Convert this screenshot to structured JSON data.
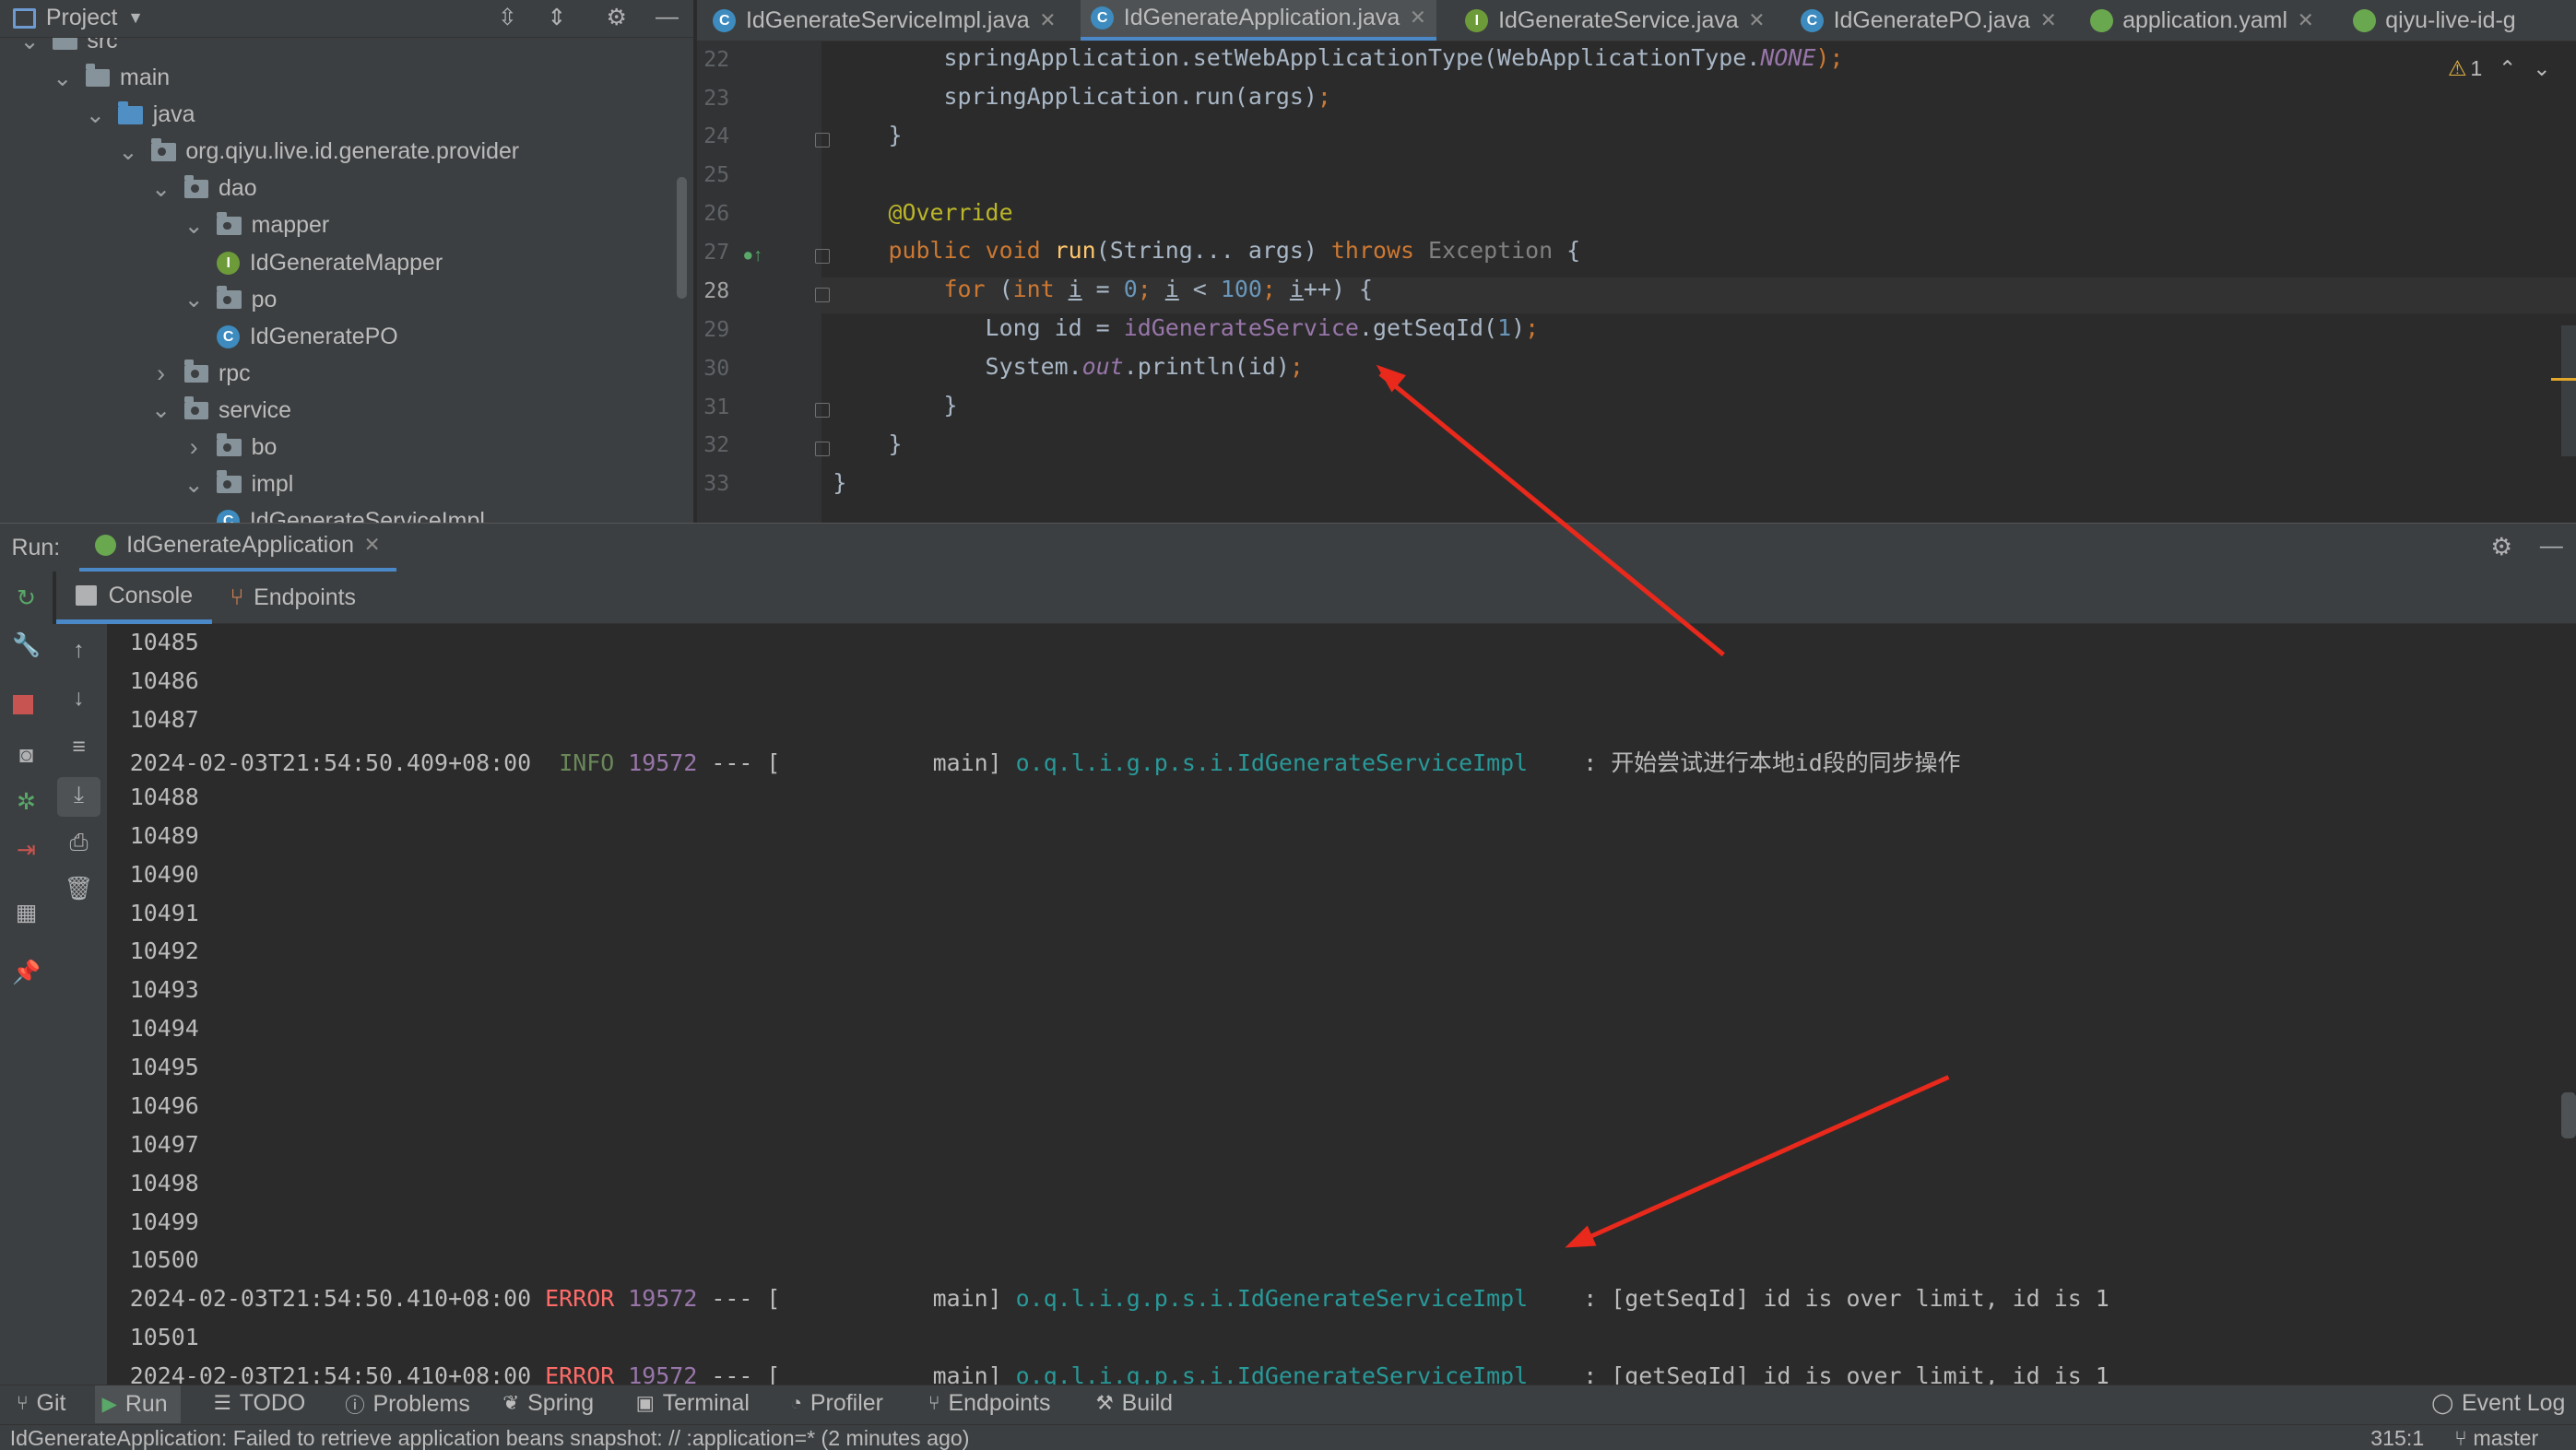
{
  "project_panel": {
    "title": "Project",
    "tree": [
      {
        "label": "src",
        "depth": 2,
        "kind": "folder",
        "expanded": true
      },
      {
        "label": "main",
        "depth": 3,
        "kind": "folder",
        "expanded": true
      },
      {
        "label": "java",
        "depth": 4,
        "kind": "folder-blue",
        "expanded": true
      },
      {
        "label": "org.qiyu.live.id.generate.provider",
        "depth": 5,
        "kind": "package",
        "expanded": true
      },
      {
        "label": "dao",
        "depth": 6,
        "kind": "package",
        "expanded": true
      },
      {
        "label": "mapper",
        "depth": 7,
        "kind": "package",
        "expanded": true
      },
      {
        "label": "IdGenerateMapper",
        "depth": 8,
        "kind": "interface"
      },
      {
        "label": "po",
        "depth": 7,
        "kind": "package",
        "expanded": true
      },
      {
        "label": "IdGeneratePO",
        "depth": 8,
        "kind": "class"
      },
      {
        "label": "rpc",
        "depth": 6,
        "kind": "package",
        "expanded": false
      },
      {
        "label": "service",
        "depth": 6,
        "kind": "package",
        "expanded": true
      },
      {
        "label": "bo",
        "depth": 7,
        "kind": "package",
        "expanded": false
      },
      {
        "label": "impl",
        "depth": 7,
        "kind": "package",
        "expanded": true
      },
      {
        "label": "IdGenerateServiceImpl",
        "depth": 8,
        "kind": "class"
      }
    ]
  },
  "editor_tabs": [
    {
      "label": "IdGenerateServiceImpl.java",
      "icon": "C",
      "kind": "class",
      "active": false
    },
    {
      "label": "IdGenerateApplication.java",
      "icon": "C",
      "kind": "class",
      "active": true
    },
    {
      "label": "IdGenerateService.java",
      "icon": "I",
      "kind": "interface",
      "active": false
    },
    {
      "label": "IdGeneratePO.java",
      "icon": "C",
      "kind": "class",
      "active": false
    },
    {
      "label": "application.yaml",
      "icon": "",
      "kind": "spring",
      "active": false
    },
    {
      "label": "qiyu-live-id-g",
      "icon": "",
      "kind": "spring",
      "active": false
    }
  ],
  "editor": {
    "warning_count": "1",
    "line_numbers": [
      "22",
      "23",
      "24",
      "25",
      "26",
      "27",
      "28",
      "29",
      "30",
      "31",
      "32",
      "33"
    ],
    "current_line": "28",
    "code": [
      [
        {
          "t": "        springApplication.setWebApplicationType(WebApplicationType.",
          "c": ""
        },
        {
          "t": "NONE",
          "c": "fld itl"
        },
        {
          "t": ");",
          "c": "kw"
        }
      ],
      [
        {
          "t": "        springApplication.run(args)",
          "c": ""
        },
        {
          "t": ";",
          "c": "kw"
        }
      ],
      [
        {
          "t": "    }",
          "c": ""
        }
      ],
      [
        {
          "t": "",
          "c": ""
        }
      ],
      [
        {
          "t": "    @Override",
          "c": "ann"
        }
      ],
      [
        {
          "t": "    ",
          "c": ""
        },
        {
          "t": "public void ",
          "c": "kw"
        },
        {
          "t": "run",
          "c": "fn"
        },
        {
          "t": "(String... args) ",
          "c": ""
        },
        {
          "t": "throws ",
          "c": "kw"
        },
        {
          "t": "Exception",
          "c": "gray"
        },
        {
          "t": " {",
          "c": ""
        }
      ],
      [
        {
          "t": "        ",
          "c": ""
        },
        {
          "t": "for ",
          "c": "kw"
        },
        {
          "t": "(",
          "c": ""
        },
        {
          "t": "int ",
          "c": "kw"
        },
        {
          "t": "i",
          "c": "ul"
        },
        {
          "t": " = ",
          "c": ""
        },
        {
          "t": "0",
          "c": "num"
        },
        {
          "t": "; ",
          "c": "kw"
        },
        {
          "t": "i",
          "c": "ul"
        },
        {
          "t": " < ",
          "c": ""
        },
        {
          "t": "100",
          "c": "num"
        },
        {
          "t": "; ",
          "c": "kw"
        },
        {
          "t": "i",
          "c": "ul"
        },
        {
          "t": "++) {",
          "c": ""
        }
      ],
      [
        {
          "t": "           Long id = ",
          "c": ""
        },
        {
          "t": "idGenerateService",
          "c": "fld"
        },
        {
          "t": ".getSeqId(",
          "c": ""
        },
        {
          "t": "1",
          "c": "num"
        },
        {
          "t": ")",
          "c": ""
        },
        {
          "t": ";",
          "c": "kw"
        }
      ],
      [
        {
          "t": "           System.",
          "c": ""
        },
        {
          "t": "out",
          "c": "fld itl"
        },
        {
          "t": ".println(id)",
          "c": ""
        },
        {
          "t": ";",
          "c": "kw"
        }
      ],
      [
        {
          "t": "        }",
          "c": ""
        }
      ],
      [
        {
          "t": "    }",
          "c": ""
        }
      ],
      [
        {
          "t": "}",
          "c": ""
        }
      ]
    ]
  },
  "run_panel": {
    "label": "Run:",
    "config_tab": "IdGenerateApplication",
    "subtabs": [
      "Console",
      "Endpoints"
    ],
    "console_lines": [
      [
        {
          "t": "10485",
          "c": ""
        }
      ],
      [
        {
          "t": "10486",
          "c": ""
        }
      ],
      [
        {
          "t": "10487",
          "c": ""
        }
      ],
      [
        {
          "t": "2024-02-03T21:54:50.409+08:00  ",
          "c": ""
        },
        {
          "t": "INFO",
          "c": "info"
        },
        {
          "t": " ",
          "c": ""
        },
        {
          "t": "19572",
          "c": "pid"
        },
        {
          "t": " --- [           main] ",
          "c": ""
        },
        {
          "t": "o.q.l.i.g.p.s.i.IdGenerateServiceImpl",
          "c": "logger"
        },
        {
          "t": "    : 开始尝试进行本地id段的同步操作",
          "c": ""
        }
      ],
      [
        {
          "t": "10488",
          "c": ""
        }
      ],
      [
        {
          "t": "10489",
          "c": ""
        }
      ],
      [
        {
          "t": "10490",
          "c": ""
        }
      ],
      [
        {
          "t": "10491",
          "c": ""
        }
      ],
      [
        {
          "t": "10492",
          "c": ""
        }
      ],
      [
        {
          "t": "10493",
          "c": ""
        }
      ],
      [
        {
          "t": "10494",
          "c": ""
        }
      ],
      [
        {
          "t": "10495",
          "c": ""
        }
      ],
      [
        {
          "t": "10496",
          "c": ""
        }
      ],
      [
        {
          "t": "10497",
          "c": ""
        }
      ],
      [
        {
          "t": "10498",
          "c": ""
        }
      ],
      [
        {
          "t": "10499",
          "c": ""
        }
      ],
      [
        {
          "t": "10500",
          "c": ""
        }
      ],
      [
        {
          "t": "2024-02-03T21:54:50.410+08:00 ",
          "c": ""
        },
        {
          "t": "ERROR",
          "c": "err"
        },
        {
          "t": " ",
          "c": ""
        },
        {
          "t": "19572",
          "c": "pid"
        },
        {
          "t": " --- [           main] ",
          "c": ""
        },
        {
          "t": "o.q.l.i.g.p.s.i.IdGenerateServiceImpl",
          "c": "logger"
        },
        {
          "t": "    : [getSeqId] id is over limit, id is 1",
          "c": ""
        }
      ],
      [
        {
          "t": "10501",
          "c": ""
        }
      ],
      [
        {
          "t": "2024-02-03T21:54:50.410+08:00 ",
          "c": ""
        },
        {
          "t": "ERROR",
          "c": "err"
        },
        {
          "t": " ",
          "c": ""
        },
        {
          "t": "19572",
          "c": "pid"
        },
        {
          "t": " --- [           main] ",
          "c": ""
        },
        {
          "t": "o.q.l.i.g.p.s.i.IdGenerateServiceImpl",
          "c": "logger"
        },
        {
          "t": "    : [getSeqId] id is over limit, id is 1",
          "c": ""
        }
      ]
    ]
  },
  "bottom_toolbar": {
    "items": [
      "Git",
      "Run",
      "TODO",
      "Problems",
      "Spring",
      "Terminal",
      "Profiler",
      "Endpoints",
      "Build"
    ],
    "right": "Event Log"
  },
  "status_bar": {
    "message": "IdGenerateApplication: Failed to retrieve application beans snapshot: // :application=* (2 minutes ago)",
    "position": "315:1",
    "branch": "master"
  },
  "colors": {
    "accent": "#4a88c7",
    "error": "#ff6b68",
    "annotation_arrow": "#e8291c"
  }
}
